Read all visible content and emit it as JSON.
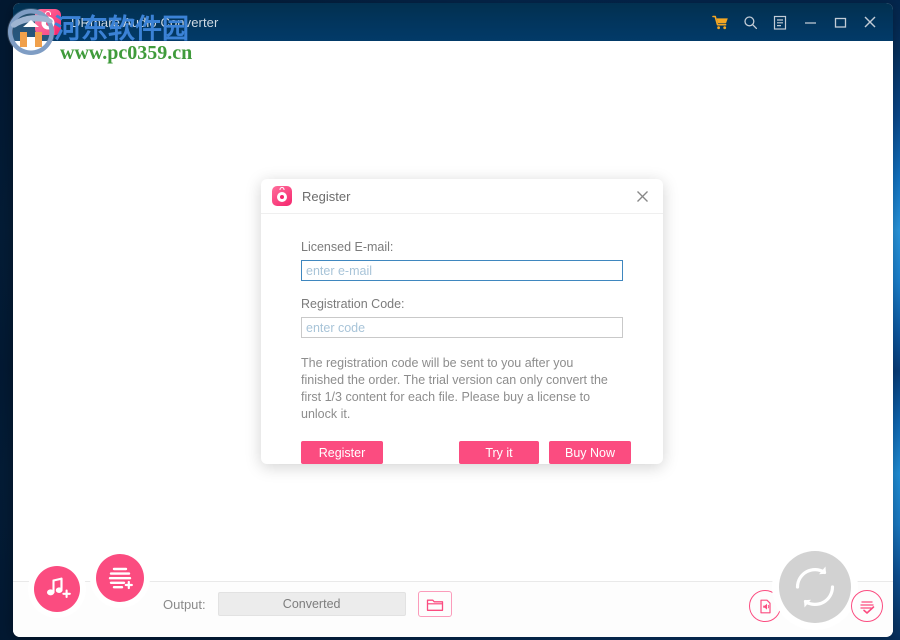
{
  "window": {
    "title": "DRmare Audio Converter",
    "app_icon": "audio-record-icon",
    "controls": [
      {
        "name": "cart-icon",
        "label": "Buy"
      },
      {
        "name": "search-icon",
        "label": "Search"
      },
      {
        "name": "menu-icon",
        "label": "Menu"
      },
      {
        "name": "minimize-icon",
        "label": "Minimize"
      },
      {
        "name": "maximize-icon",
        "label": "Maximize"
      },
      {
        "name": "close-icon",
        "label": "Close"
      }
    ]
  },
  "watermark": {
    "chinese": "河东软件园",
    "url": "www.pc0359.cn",
    "chinese_color": "#3b82d6",
    "url_color": "#3f9b3b"
  },
  "dialog": {
    "icon": "audio-record-icon",
    "title": "Register",
    "close_label": "Close",
    "email": {
      "label": "Licensed E-mail:",
      "placeholder": "enter e-mail",
      "value": "",
      "focused": true
    },
    "code": {
      "label": "Registration Code:",
      "placeholder": "enter code",
      "value": "",
      "focused": false
    },
    "note": "The registration code will be sent to you after you finished the order. The trial version can only convert the first 1/3 content for each file. Please buy a license to unlock it.",
    "buttons": {
      "register": "Register",
      "try_it": "Try it",
      "buy_now": "Buy Now"
    },
    "accent_color": "#fb4c80"
  },
  "bottom_bar": {
    "add_audio_icon": "music-note-plus-icon",
    "add_list_icon": "playlist-plus-icon",
    "output_label": "Output:",
    "output_value": "Converted",
    "browse_icon": "folder-icon",
    "audio_file_icon": "audio-file-icon",
    "done_list_icon": "checked-list-icon",
    "convert_icon": "convert-refresh-icon"
  },
  "colors": {
    "titlebar": "#02355d",
    "accent_pink": "#fb4c80",
    "cart_orange": "#f5a623",
    "desktop_blue": "#1277c9"
  }
}
